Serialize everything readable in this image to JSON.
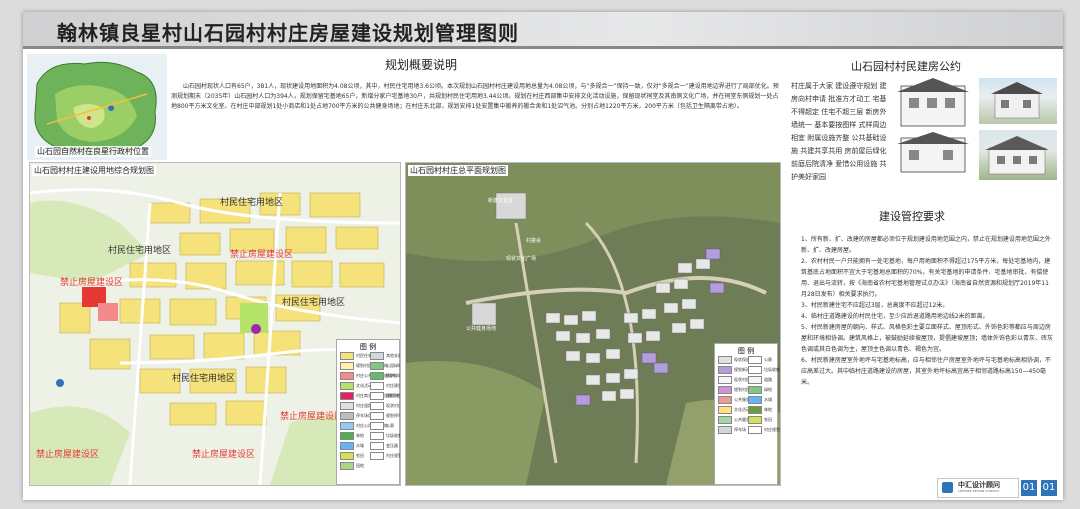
{
  "title": "翰林镇良星村山石园村村庄房屋建设规划管理图则",
  "overview": {
    "heading": "规划概要说明",
    "text": "山石园村现状人口有65户，381人，现状建设用地面积为4.08公顷，其中，村民住宅用地3.6公顷。本次规划山石园村村庄建设用地总量为4.08公顷，与“多规合一”保持一致，仅对“多规合一”建设用地边界进行了局部优化。预测规划期末（2035年）山石园村人口为394人，规划保留宅基地65户，新增分家户宅基地30户，共规划村民住宅用地3.44公顷。规划在村庄西部集中安排文化活动设施，保留现状祠堂及其南侧文化广场，并在祠堂东侧规划一处占地800平方米文化室。在村庄中部规划1处小商店和1处占地700平方米的公共健身场地；在村庄东北部，规划安排1处安置集中搬养的搬合舍和1处沼气池。分别占地1220平方米，200平方米（包括卫生隔离带占地）。"
  },
  "location_map": {
    "caption": "山石园自然村在良星行政村位置"
  },
  "left_map": {
    "title": "山石园村村庄建设用地综合规划图",
    "zones": [
      {
        "label": "村民住宅用地区",
        "color": "dark"
      },
      {
        "label": "村民住宅用地区",
        "color": "dark"
      },
      {
        "label": "禁止房屋建设区",
        "color": "red"
      },
      {
        "label": "禁止房屋建设区",
        "color": "red"
      },
      {
        "label": "村民住宅用地区",
        "color": "dark"
      },
      {
        "label": "村民住宅用地区",
        "color": "dark"
      },
      {
        "label": "禁止房屋建设区",
        "color": "red"
      },
      {
        "label": "禁止房屋建设区",
        "color": "red"
      },
      {
        "label": "禁止房屋建设区",
        "color": "red"
      }
    ],
    "legend": {
      "heading": "图 例",
      "items": [
        "村民住宅用地",
        "规划村民住宅用地",
        "村庄公共服务设施用地",
        "文化活动场地",
        "村庄商业服务业设施用地",
        "村庄道路用地",
        "停车场用地",
        "村庄公用设施用地",
        "林地",
        "水域",
        "农田",
        "园地",
        "其他非建设用地",
        "公园绿地",
        "防护绿地",
        "村庄建设边界",
        "规划村庄道路",
        "现状村庄道路",
        "规划停车场",
        "公厕",
        "垃圾收集点",
        "变压器",
        "村庄规划范围"
      ]
    }
  },
  "plan_map": {
    "title": "山石园村村庄总平面规划图",
    "labels": [
      "新建文化室",
      "公共健身场地",
      "现状文化广场",
      "村委会"
    ],
    "legend": {
      "heading": "图 例",
      "items": [
        "现状保留住宅",
        "规划新建住宅",
        "现状村民住宅",
        "规划村民住宅",
        "公共服务设施",
        "文化活动场地",
        "公共健身场地",
        "停车场",
        "公厕",
        "垃圾收集点",
        "道路",
        "绿地",
        "水域",
        "林地",
        "农田",
        "村庄规划范围"
      ]
    }
  },
  "convention": {
    "heading": "山石园村村民建房公约",
    "text": "村庄属于大家 建设遵守规划 建房向村申请 批准方才动工 宅基不得超定 住宅不超三层 新房外墙统一 基本要按图样 式样周边相宜 附属设施齐整 公共基础设施 共建共享共用 房前屋后绿化 前庭后院清净 爱惜公用设施 共护美好家园"
  },
  "requirements": {
    "heading": "建设管控要求",
    "items": [
      "1、所有新、扩、改建的房屋都必须位于规划建设用地范围之内，禁止在规划建设用地范围之外新、扩、改建房屋。",
      "2、农村村民一户只能拥有一处宅基地，每户用地面积不得超过175平方米，每处宅基地内，建筑基底占地面积不宜大于宅基地总面积的70%，有关宅基地的申请条件、宅基地审批、有偿使用、退出与流转，按《海南省农村宅基地管理试点办法》（海南省自然资源和规划厅2019年11月28日发布）相关要求执行。",
      "3、村民新建住宅不应超过3层，总高度不应超过12米。",
      "4、临村庄道路建设的村民住宅，至少应后退道路用地边线2米的距离。",
      "5、村民新建房屋的朝向、样式、风格色彩主要立面样式、屋顶形式、外饰色彩等都应与周边房屋和环境相协调。建筑风格上，被鼓励延续坡屋顶，提倡建坡屋顶；墙体外饰色彩以青灰、砖灰色调或其白色调为主，屋顶主色调以青色、褐色为宜。",
      "6、村民新建房屋室外地坪与宅基地标高，应与相邻住户房屋室外地坪与宅基地标高相协调，不应高差过大。其中临村庄道路建设的房屋，其室外地坪标高宜高于相邻道路标高150—450毫米。"
    ]
  },
  "footer": {
    "company": "中汇设计顾问",
    "company_sub": "LIFEFREE DESIGN CONSULT",
    "page_a": "01",
    "page_b": "01"
  },
  "colors": {
    "accent_blue": "#2f74b8",
    "forbid_red": "#e53935",
    "residential_yellow": "#f6e27a"
  }
}
